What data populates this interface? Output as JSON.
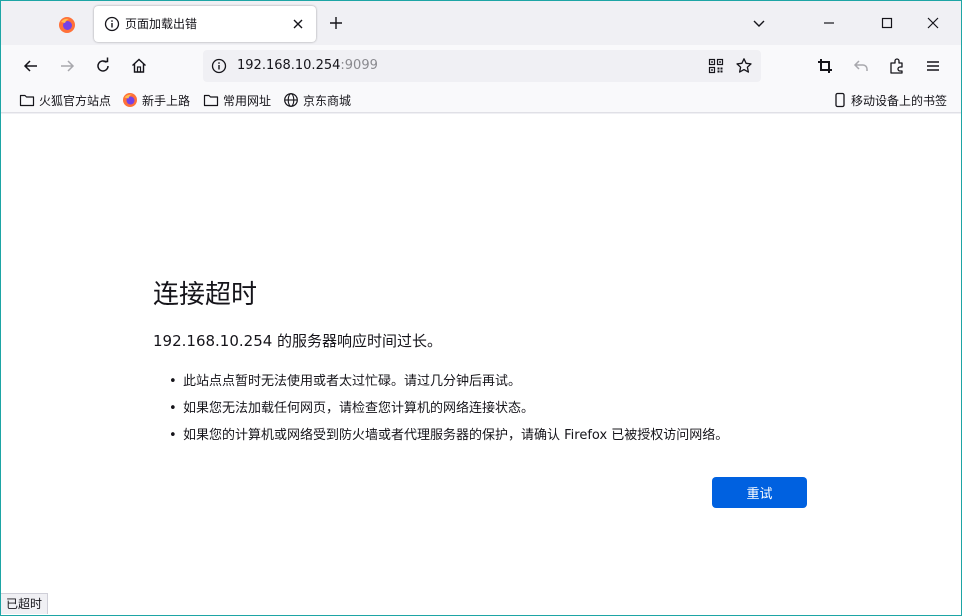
{
  "tabs": {
    "active_title": "页面加载出错"
  },
  "urlbar": {
    "host": "192.168.10.254",
    "port": ":9099"
  },
  "bookmarks": {
    "items": [
      {
        "label": "火狐官方站点",
        "icon": "folder-icon"
      },
      {
        "label": "新手上路",
        "icon": "firefox-icon"
      },
      {
        "label": "常用网址",
        "icon": "folder-icon"
      },
      {
        "label": "京东商城",
        "icon": "globe-icon"
      }
    ],
    "mobile": "移动设备上的书签"
  },
  "error": {
    "title": "连接超时",
    "description": "192.168.10.254 的服务器响应时间过长。",
    "tips": [
      "此站点点暂时无法使用或者太过忙碌。请过几分钟后再试。",
      "如果您无法加载任何网页，请检查您计算机的网络连接状态。",
      "如果您的计算机或网络受到防火墙或者代理服务器的保护，请确认 Firefox 已被授权访问网络。"
    ],
    "retry_label": "重试"
  },
  "status": {
    "text": "已超时"
  },
  "colors": {
    "accent": "#0061e0",
    "window_border": "#1da5a5"
  }
}
